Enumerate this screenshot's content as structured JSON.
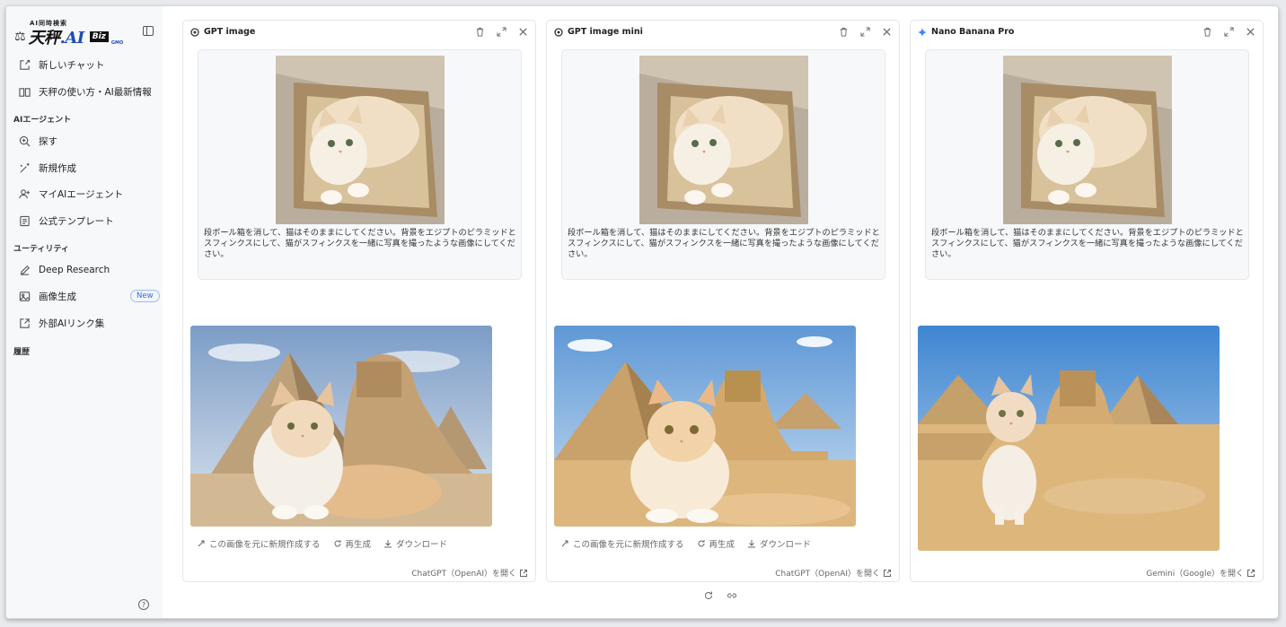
{
  "sidebar": {
    "brand_sub": "AI同時検索",
    "brand_main": "天秤",
    "brand_ai": ".AI",
    "brand_biz": "Biz",
    "brand_gmo": "GMO",
    "items": [
      {
        "label": "新しいチャット",
        "icon": "edit-icon"
      },
      {
        "label": "天秤の使い方・AI最新情報",
        "icon": "book-icon"
      }
    ],
    "section_agents": "AIエージェント",
    "agent_items": [
      {
        "label": "探す",
        "icon": "search-icon"
      },
      {
        "label": "新規作成",
        "icon": "magic-wand-icon"
      },
      {
        "label": "マイAIエージェント",
        "icon": "user-plus-icon"
      },
      {
        "label": "公式テンプレート",
        "icon": "template-icon"
      }
    ],
    "section_utility": "ユーティリティ",
    "utility_items": [
      {
        "label": "Deep Research",
        "icon": "pen-icon"
      },
      {
        "label": "画像生成",
        "icon": "image-icon",
        "badge": "New"
      },
      {
        "label": "外部AIリンク集",
        "icon": "external-link-icon"
      }
    ],
    "section_history": "履歴",
    "help": "?"
  },
  "prompt": "段ボール箱を消して、猫はそのままにしてください。背景をエジプトのピラミッドとスフィンクスにして、猫がスフィンクスを一緒に写真を撮ったような画像にしてください。",
  "panels": [
    {
      "model": "GPT image",
      "model_icon": "openai-icon",
      "actions": {
        "new_from_image": "この画像を元に新規作成する",
        "regenerate": "再生成",
        "download": "ダウンロード"
      },
      "open_link": "ChatGPT（OpenAI）を開く"
    },
    {
      "model": "GPT image mini",
      "model_icon": "openai-icon",
      "actions": {
        "new_from_image": "この画像を元に新規作成する",
        "regenerate": "再生成",
        "download": "ダウンロード"
      },
      "open_link": "ChatGPT（OpenAI）を開く"
    },
    {
      "model": "Nano Banana Pro",
      "model_icon": "gemini-sparkle-icon",
      "open_link": "Gemini（Google）を開く"
    }
  ],
  "colors": {
    "accent": "#2f6fde",
    "sidebar_bg": "#f7f8fa",
    "card_bg": "#f7f8fa"
  }
}
